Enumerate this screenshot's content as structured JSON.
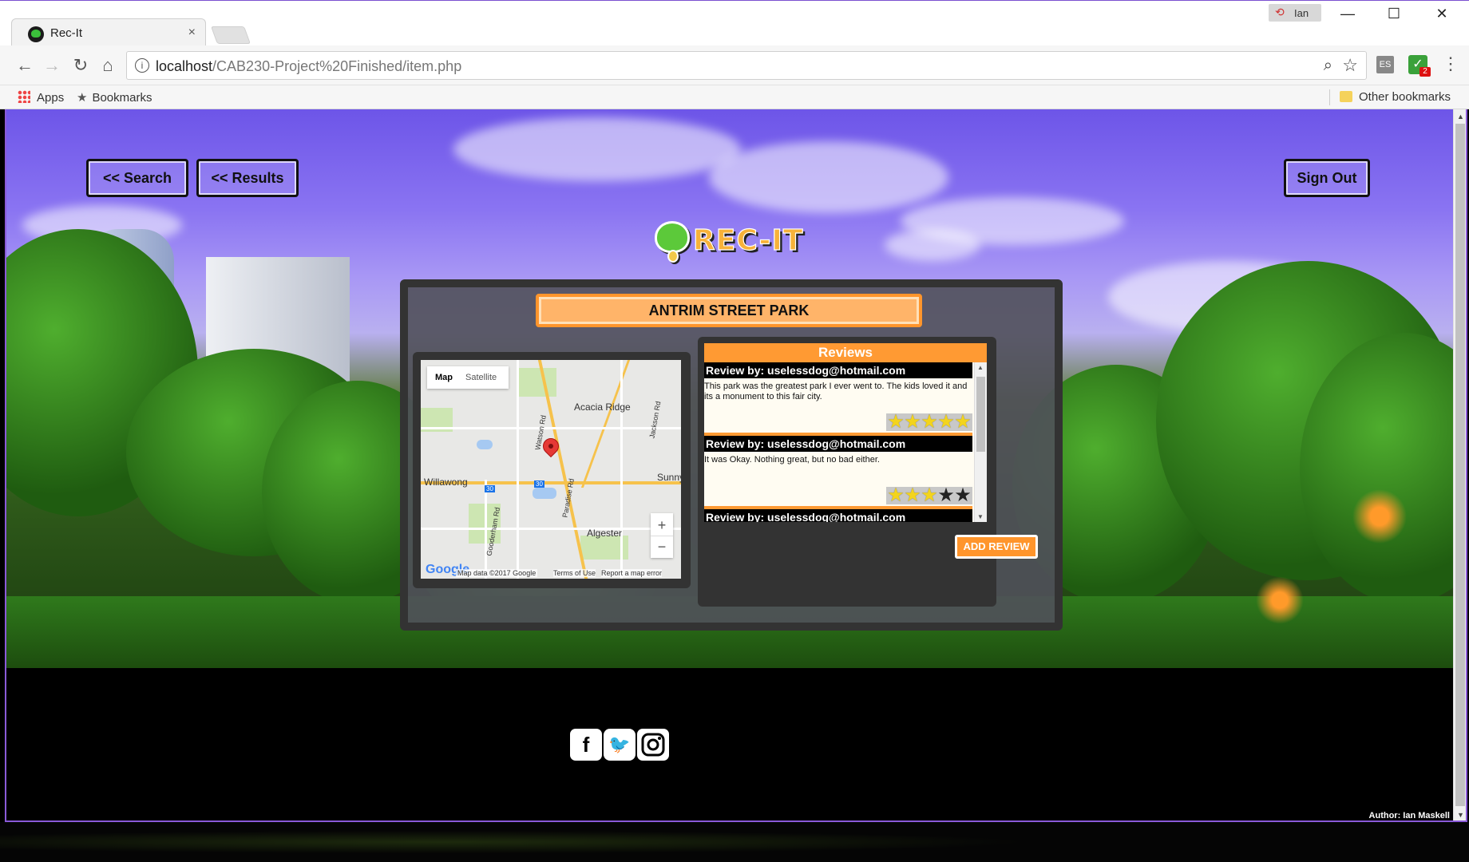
{
  "browser": {
    "tab_title": "Rec-It",
    "tab_close": "×",
    "profile_name": "Ian",
    "url_host": "localhost",
    "url_path": "/CAB230-Project%20Finished/item.php",
    "window_controls": {
      "minimize": "—",
      "maximize": "☐",
      "close": "✕"
    },
    "extension_badge": "2",
    "bookmarks": {
      "apps": "Apps",
      "bookmarks": "Bookmarks",
      "other": "Other bookmarks"
    }
  },
  "nav": {
    "search": "<< Search",
    "results": "<< Results",
    "sign_out": "Sign Out"
  },
  "logo": {
    "text": "REC-IT"
  },
  "item": {
    "title": "ANTRIM STREET PARK"
  },
  "map": {
    "type_map": "Map",
    "type_satellite": "Satellite",
    "labels": {
      "acacia_ridge": "Acacia Ridge",
      "willawong": "Willawong",
      "algester": "Algester",
      "sunny": "Sunny",
      "watson_rd": "Watson Rd",
      "paradise_rd": "Paradise Rd",
      "gooderham_rd": "Gooderham Rd",
      "jackson_rd": "Jackson Rd",
      "route30a": "30",
      "route30b": "30"
    },
    "zoom_in": "+",
    "zoom_out": "−",
    "google": "Google",
    "data": "Map data ©2017 Google",
    "terms": "Terms of Use",
    "report": "Report a map error"
  },
  "reviews": {
    "heading": "Reviews",
    "items": [
      {
        "by": "Review by: uselessdog@hotmail.com",
        "text": "This park was the greatest park I ever went to. The kids loved it and its a monument to this fair city.",
        "rating": 5
      },
      {
        "by": "Review by: uselessdog@hotmail.com",
        "text": "It was Okay. Nothing great, but no bad either.",
        "rating": 3
      },
      {
        "by": "Review by: uselessdog@hotmail.com",
        "text": "",
        "rating": 0
      }
    ],
    "add_button": "ADD REVIEW"
  },
  "footer": {
    "author": "Author: Ian Maskell",
    "icons": [
      "facebook-icon",
      "twitter-icon",
      "instagram-icon"
    ]
  },
  "colors": {
    "accent": "#ff952c",
    "title_fill": "#ffb469",
    "reviews_header": "#ff9a33",
    "sky": "#8a74f2"
  }
}
